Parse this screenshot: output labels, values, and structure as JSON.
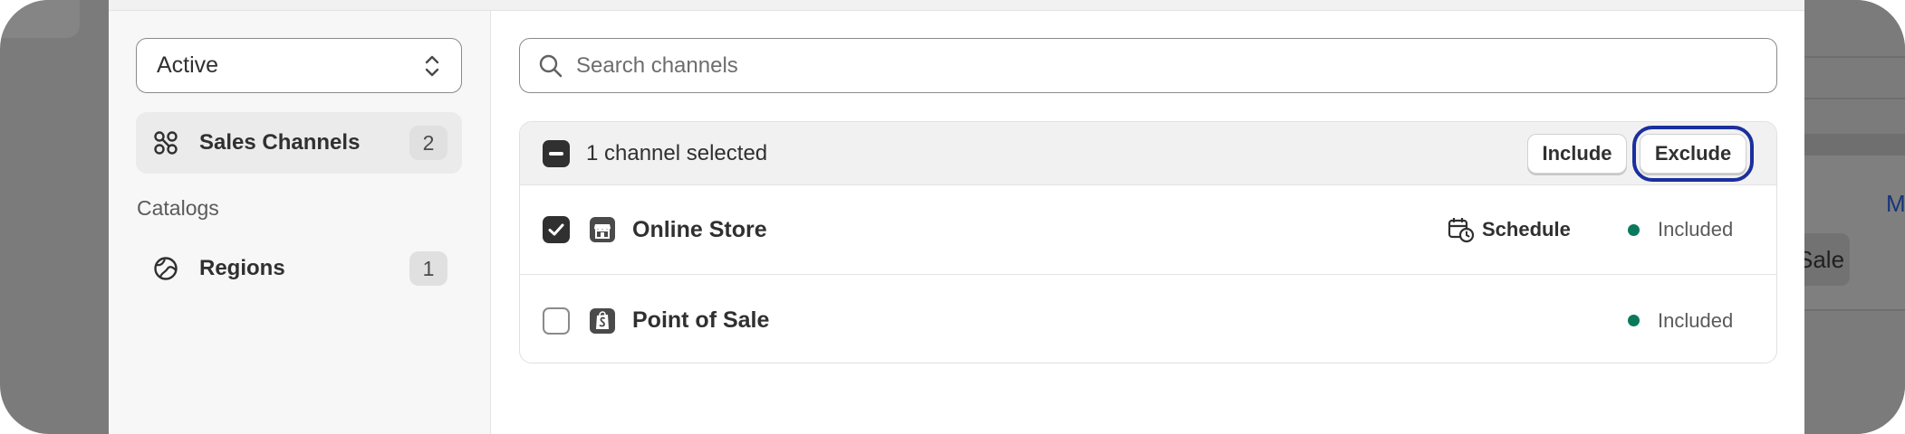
{
  "colors": {
    "backdrop": "#7b7b7b",
    "focus_ring": "#1b2f9e",
    "status_included": "#0b7a5c",
    "checkbox_fill": "#303030"
  },
  "sidebar": {
    "status_select": {
      "value": "Active",
      "icon": "chevron-up-down-icon"
    },
    "items": [
      {
        "label": "Sales Channels",
        "count": "2",
        "icon": "sales-channels-icon",
        "active": true
      },
      {
        "label": "Regions",
        "count": "1",
        "icon": "globe-icon",
        "active": false
      }
    ],
    "section_catalogs": "Catalogs"
  },
  "search": {
    "placeholder": "Search channels",
    "icon": "search-icon"
  },
  "bulk_bar": {
    "selected_text": "1 channel selected",
    "include_label": "Include",
    "exclude_label": "Exclude"
  },
  "channels": [
    {
      "name": "Online Store",
      "icon": "store-icon",
      "checked": true,
      "schedule_label": "Schedule",
      "schedule_icon": "calendar-clock-icon",
      "status": "Included"
    },
    {
      "name": "Point of Sale",
      "icon": "shopify-pos-icon",
      "checked": false,
      "status": "Included"
    }
  ],
  "background": {
    "link_fragment": "M",
    "chip_fragment": "Sale"
  }
}
